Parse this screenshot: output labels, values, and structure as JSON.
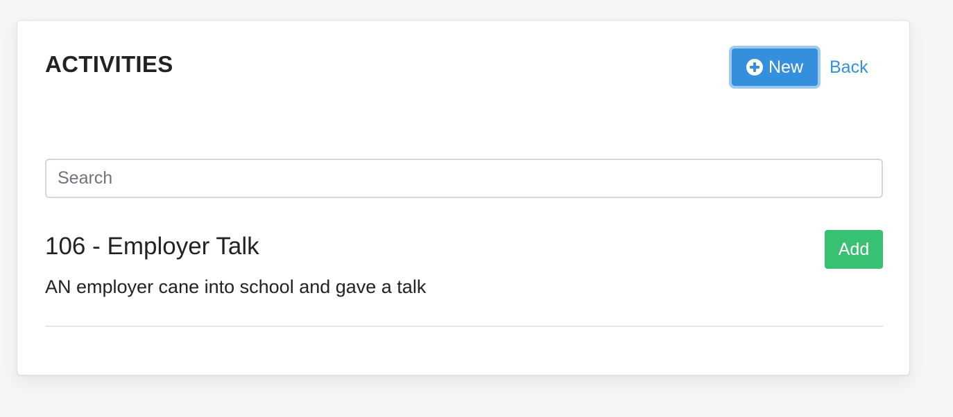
{
  "page": {
    "title": "ACTIVITIES"
  },
  "header": {
    "new_label": "New",
    "back_label": "Back"
  },
  "search": {
    "placeholder": "Search",
    "value": ""
  },
  "activities": [
    {
      "title": "106 - Employer Talk",
      "description": "AN employer cane into school and gave a talk",
      "add_label": "Add"
    }
  ],
  "colors": {
    "primary": "#3490dc",
    "success": "#38c172",
    "background": "#f5f6f8"
  },
  "icons": {
    "new_button_icon": "plus-circle-icon"
  }
}
